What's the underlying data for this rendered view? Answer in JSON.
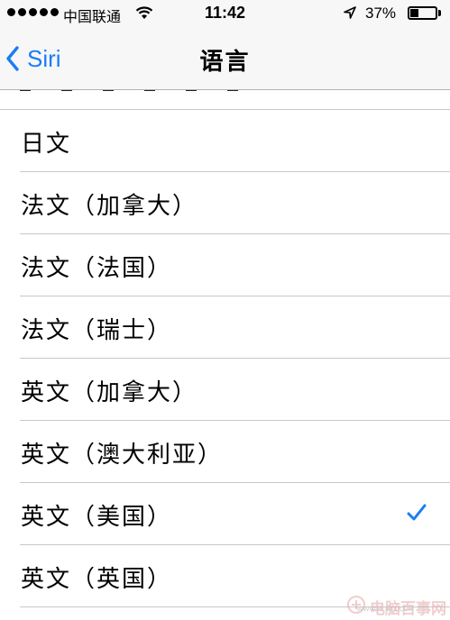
{
  "status_bar": {
    "carrier": "中国联通",
    "time": "11:42",
    "battery_percent_text": "37%",
    "battery_level": 0.37,
    "signal_bars": 5
  },
  "nav": {
    "back_label": "Siri",
    "title": "语言"
  },
  "languages": [
    {
      "label": "日文",
      "selected": false
    },
    {
      "label": "法文（加拿大）",
      "selected": false
    },
    {
      "label": "法文（法国）",
      "selected": false
    },
    {
      "label": "法文（瑞士）",
      "selected": false
    },
    {
      "label": "英文（加拿大）",
      "selected": false
    },
    {
      "label": "英文（澳大利亚）",
      "selected": false
    },
    {
      "label": "英文（美国）",
      "selected": true
    },
    {
      "label": "英文（英国）",
      "selected": false
    }
  ],
  "watermark": {
    "text": "电脑百事网",
    "sub": "WWW.PC841.COM"
  },
  "colors": {
    "accent": "#1a7cf5",
    "bar_background": "#f7f7f8",
    "separator": "#c8c7cc"
  },
  "icons": {
    "back": "chevron-left-icon",
    "wifi": "wifi-icon",
    "location": "location-arrow-icon",
    "battery": "battery-icon",
    "check": "checkmark-icon"
  }
}
